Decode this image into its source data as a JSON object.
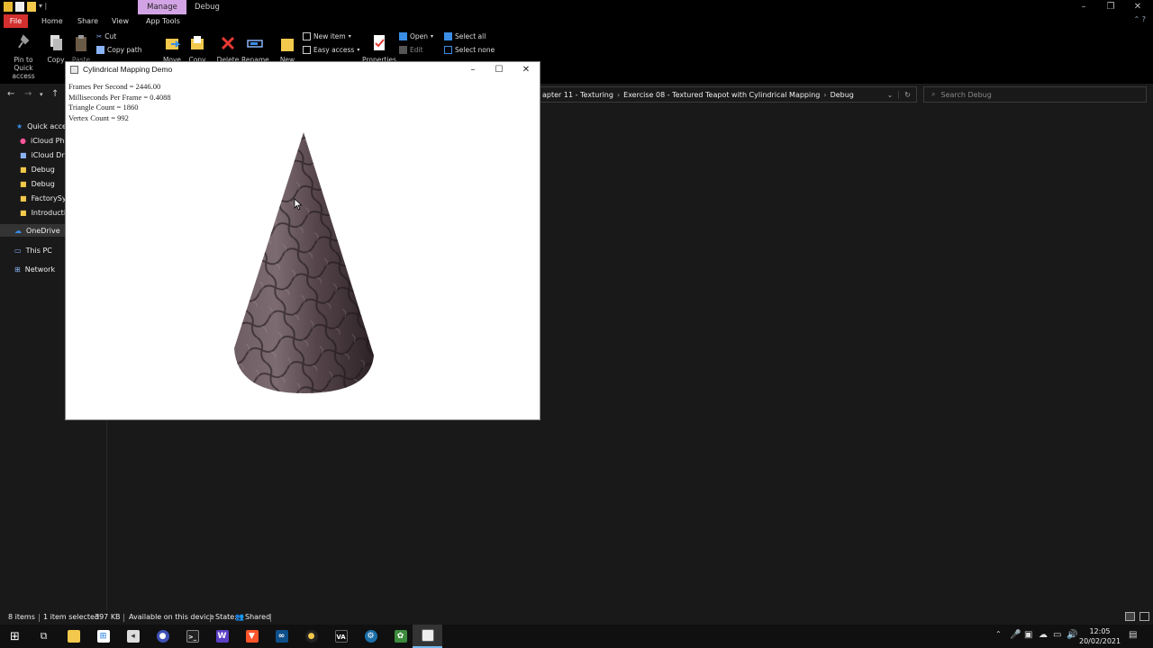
{
  "explorer": {
    "context_tab": "Manage",
    "window_title": "Debug",
    "ribbon_tabs": [
      "File",
      "Home",
      "Share",
      "View",
      "App Tools"
    ],
    "ribbon": {
      "pin": "Pin to Quick",
      "pin2": "access",
      "copy": "Copy",
      "paste": "Paste",
      "cut": "Cut",
      "copy_path": "Copy path",
      "move": "Move",
      "copy_to": "Copy",
      "delete": "Delete",
      "rename": "Rename",
      "new": "New",
      "new_item": "New item",
      "easy_access": "Easy access",
      "properties": "Properties",
      "open": "Open",
      "edit": "Edit",
      "select_all": "Select all",
      "select_none": "Select none"
    },
    "address": [
      "apter 11 - Texturing",
      "Exercise 08 - Textured Teapot with Cylindrical Mapping",
      "Debug"
    ],
    "search_placeholder": "Search Debug",
    "nav": [
      "Quick acces",
      "iCloud Pho",
      "iCloud Dri",
      "Debug",
      "Debug",
      "FactorySys",
      "Introductio",
      "OneDrive",
      "This PC",
      "Network"
    ],
    "status": {
      "items": "8 items",
      "selected": "1 item selected",
      "size": "397 KB",
      "availability": "Available on this device",
      "state": "State:",
      "shared": "Shared"
    }
  },
  "demo": {
    "title": "Cylindrical Mapping Demo",
    "stats": [
      "Frames Per Second = 2446.00",
      "Milliseconds Per Frame = 0.4088",
      "Triangle Count = 1860",
      "Vertex Count = 992"
    ]
  },
  "taskbar": {
    "time": "12:05",
    "date": "20/02/2021"
  },
  "colors": {
    "file_tab": "#d32f2f",
    "manage_tab": "#d3a4e5",
    "accent": "#76b9ed"
  }
}
